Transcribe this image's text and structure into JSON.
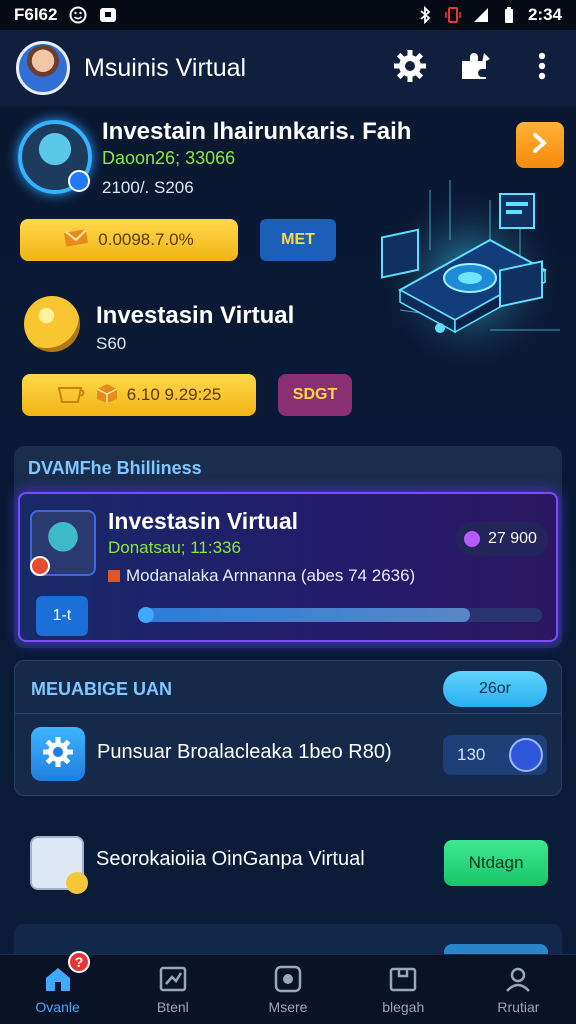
{
  "status_bar": {
    "left_text": "F6l62",
    "time": "2:34"
  },
  "app_bar": {
    "title": "Msuinis Virtual"
  },
  "card1": {
    "title": "Investain Ihairunkaris. Faih",
    "green_text": "Daoon26; 33066",
    "sub_text": "2100/. S206",
    "pill_value": "0.0098.7.0%",
    "blue_button": "MET"
  },
  "card2": {
    "title": "Investasin Virtual",
    "sub_text": "S60",
    "pill_value": "6.10 9.29:25",
    "purple_button": "SDGT"
  },
  "panel1": {
    "header": "DVAMFhe Bhilliness",
    "item": {
      "title": "Investasin Virtual",
      "green_text": "Donatsau; 11:336",
      "description": "Modanalaka Arnnanna (abes 74 2636)",
      "value": "27 900",
      "button": "1-t",
      "progress": 0.82
    }
  },
  "panel2": {
    "header": "MEUABIGE UAN",
    "cyan_button": "26or",
    "row_text": "Punsuar Broalacleaka 1beo R80)",
    "toggle_value": "130"
  },
  "card3": {
    "text": "Seorokaioiia OinGanpa Virtual",
    "green_button": "Ntdagn"
  },
  "bottom_nav": {
    "items": [
      {
        "label": "Ovanle",
        "icon": "home-icon",
        "active": true,
        "badge": "?"
      },
      {
        "label": "Btenl",
        "icon": "chart-icon"
      },
      {
        "label": "Msere",
        "icon": "record-icon"
      },
      {
        "label": "blegah",
        "icon": "folder-icon"
      },
      {
        "label": "Rrutiar",
        "icon": "user-icon"
      }
    ]
  },
  "colors": {
    "background": "#0b1730",
    "accent_blue": "#3fa8ff",
    "accent_green": "#8be83a",
    "accent_yellow": "#f2b417",
    "accent_orange": "#f58a0c",
    "accent_purple": "#7a4cff"
  }
}
